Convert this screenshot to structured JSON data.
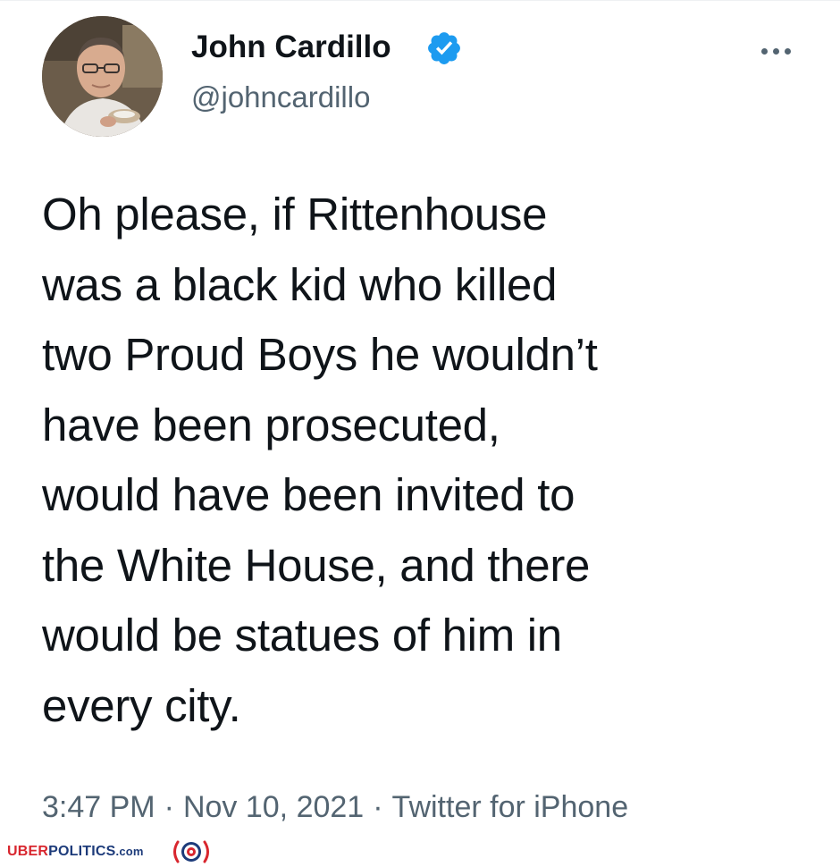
{
  "tweet": {
    "author_name": "John Cardillo",
    "handle": "@johncardillo",
    "text": "Oh please, if Rittenhouse\nwas a black kid who killed\ntwo Proud Boys he wouldn’t\nhave been prosecuted,\nwould have been invited to\nthe White House, and there\nwould be statues of him in\nevery city.",
    "time": "3:47 PM",
    "date": "Nov 10, 2021",
    "source": "Twitter for iPhone",
    "separator": "·"
  },
  "icons": {
    "verified": "verified-badge-icon",
    "more": "more-options-icon"
  },
  "watermark": {
    "brand_part1": "UBER",
    "brand_part2": "POLITICS",
    "brand_suffix": ".com"
  },
  "colors": {
    "text_primary": "#0f1419",
    "text_secondary": "#536471",
    "verified_blue": "#1d9bf0",
    "brand_red": "#d8262e",
    "brand_blue": "#1d3b7a"
  }
}
